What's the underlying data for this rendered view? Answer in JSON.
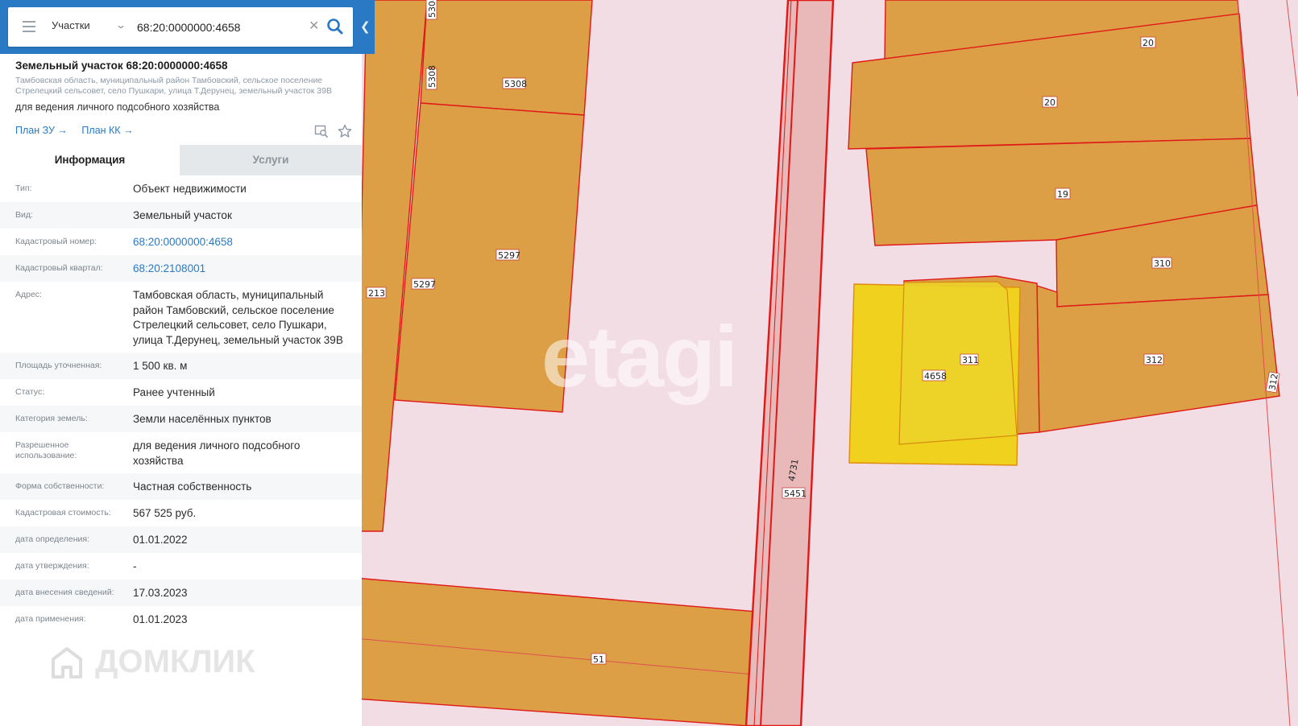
{
  "search": {
    "layer": "Участки",
    "query": "68:20:0000000:4658"
  },
  "card": {
    "title": "Земельный участок 68:20:0000000:4658",
    "address": "Тамбовская область, муниципальный район Тамбовский, сельское поселение Стрелецкий сельсовет, село Пушкари, улица Т.Дерунец, земельный участок 39В",
    "usage": "для ведения личного подсобного хозяйства",
    "links": [
      "План ЗУ →",
      "План КК →"
    ],
    "icons": [
      "search-on-map-icon",
      "star-icon"
    ]
  },
  "tabs": [
    {
      "label": "Информация",
      "active": true
    },
    {
      "label": "Услуги",
      "active": false
    }
  ],
  "info_rows": [
    {
      "key": "Тип:",
      "value": "Объект недвижимости"
    },
    {
      "key": "Вид:",
      "value": "Земельный участок"
    },
    {
      "key": "Кадастровый номер:",
      "value": "68:20:0000000:4658",
      "link": true
    },
    {
      "key": "Кадастровый квартал:",
      "value": "68:20:2108001",
      "link": true
    },
    {
      "key": "Адрес:",
      "value": "Тамбовская область, муниципальный район Тамбовский, сельское поселение Стрелецкий сельсовет, село Пушкари, улица Т.Дерунец, земельный участок 39В"
    },
    {
      "key": "Площадь уточненная:",
      "value": "1 500 кв. м"
    },
    {
      "key": "Статус:",
      "value": "Ранее учтенный"
    },
    {
      "key": "Категория земель:",
      "value": "Земли населённых пунктов"
    },
    {
      "key": "Разрешенное использование:",
      "value": "для ведения личного подсобного хозяйства"
    },
    {
      "key": "Форма собственности:",
      "value": "Частная собственность"
    },
    {
      "key": "Кадастровая стоимость:",
      "value": "567 525 руб."
    },
    {
      "key": "дата определения:",
      "value": "01.01.2022"
    },
    {
      "key": "дата утверждения:",
      "value": "-"
    },
    {
      "key": "дата внесения сведений:",
      "value": "17.03.2023"
    },
    {
      "key": "дата применения:",
      "value": "01.01.2023"
    }
  ],
  "map": {
    "parcel_labels": [
      "5308",
      "5308",
      "5297",
      "5297",
      "213",
      "20",
      "20",
      "19",
      "310",
      "311",
      "4658",
      "312",
      "312",
      "4731",
      "5451",
      "51"
    ],
    "watermark": "etagi",
    "colors": {
      "parcel": "#dc9f45",
      "selected": "#f0d21e",
      "border": "#e01818",
      "background": "#f3dde5"
    }
  },
  "watermark_brand": "ДОМКЛИК",
  "colors": {
    "accent": "#2a79c4",
    "link": "#2a79c4"
  }
}
